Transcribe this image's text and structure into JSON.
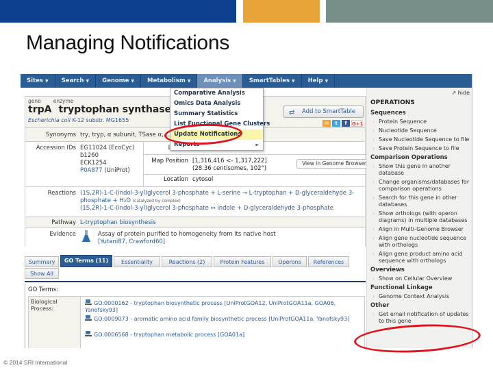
{
  "slide": {
    "title": "Managing Notifications",
    "footer": "© 2014 SRI International",
    "colors": {
      "blue": "#0d4190",
      "orange": "#e8a43a",
      "gray": "#788e88",
      "annotation": "#e0141c"
    }
  },
  "nav": {
    "items": [
      {
        "label": "Sites"
      },
      {
        "label": "Search"
      },
      {
        "label": "Genome"
      },
      {
        "label": "Metabolism"
      },
      {
        "label": "Analysis",
        "active": true
      },
      {
        "label": "SmartTables"
      },
      {
        "label": "Help"
      }
    ],
    "caret": "▼"
  },
  "analysis_menu": {
    "items": [
      {
        "label": "Comparative Analysis"
      },
      {
        "label": "Omics Data Analysis"
      },
      {
        "label": "Summary Statistics"
      },
      {
        "label": "List Functional Gene Clusters"
      },
      {
        "label": "Update Notifications",
        "highlighted": true
      },
      {
        "label": "Reports",
        "submenu": true
      }
    ],
    "submenu_arrow": "►"
  },
  "gene": {
    "type_label": "gene",
    "enzyme_label": "enzyme",
    "symbol": "trpA",
    "name": "tryptophan synthase, α subunit",
    "organism_italic": "Escherichia coli",
    "organism_rest": " K-12 substr. MG1655",
    "add_smarttable": "Add to SmartTable",
    "share_icons": [
      "email",
      "twitter",
      "facebook",
      "G+1"
    ],
    "synonyms_label": "Synonyms",
    "synonyms": "try, tryp, α subunit, TSase α, ...",
    "accession_label": "Accession IDs",
    "accessions": [
      "EG11024 (EcoCyc)",
      "b1260",
      "ECK1254"
    ],
    "accession_link": "P0A877",
    "accession_link_suffix": " (UniProt)",
    "length_label": "Length",
    "map_position_label": "Map Position",
    "map_position": "[1,316,416 <- 1,317,222]",
    "map_position_2": "(28.36 centisomes, 102°)",
    "genome_browser_button": "View in Genome Browser",
    "location_label": "Location",
    "location": "cytosol",
    "reactions_label": "Reactions",
    "reaction_1": "(1S,2R)-1-C-(indol-3-yl)glycerol 3-phosphate + L-serine → L-tryptophan + D-glyceraldehyde 3-phosphate + H₂O",
    "reaction_1_note": "(catalyzed by complex)",
    "reaction_2": "(1S,2R)-1-C-(indol-3-yl)glycerol 3-phosphate ↔ indole + D-glyceraldehyde 3-phosphate",
    "pathway_label": "Pathway",
    "pathway": "L-tryptophan biosynthesis",
    "evidence_label": "Evidence",
    "evidence_text": "Assay of protein purified to homogeneity from its native host",
    "evidence_refs": "[Yutani87, Crawford60]"
  },
  "tabs": {
    "items": [
      {
        "label": "Summary"
      },
      {
        "label": "GO Terms (11)",
        "active": true
      },
      {
        "label": "Essentiality"
      },
      {
        "label": "Reactions (2)"
      },
      {
        "label": "Protein Features"
      },
      {
        "label": "Operons"
      },
      {
        "label": "References"
      },
      {
        "label": "Show All"
      }
    ]
  },
  "go_terms": {
    "title": "GO Terms:",
    "category": "Biological Process:",
    "items": [
      {
        "text": "GO:0000162 - tryptophan biosynthetic process [UniProtGOA12, UniProtGOA11a, GOA06, Yanofsky93]"
      },
      {
        "text": "GO:0009073 - aromatic amino acid family biosynthetic process [UniProtGOA11a, Yanofsky93]"
      },
      {
        "text": "GO:0006568 - tryptophan metabolic process [GOA01a]"
      }
    ]
  },
  "operations": {
    "hide_label": "hide",
    "title": "OPERATIONS",
    "sections": [
      {
        "heading": "Sequences",
        "items": [
          "Protein Sequence",
          "Nucleotide Sequence",
          "Save Nucleotide Sequence to file",
          "Save Protein Sequence to file"
        ]
      },
      {
        "heading": "Comparison Operations",
        "items": [
          "Show this gene in another database",
          "Change organisms/databases for comparison operations",
          "Search for this gene in other databases",
          "Show orthologs (with operon diagrams) in multiple databases",
          "Align in Multi-Genome Browser",
          "Align gene nucleotide sequence with orthologs",
          "Align gene product amino acid sequence with orthologs"
        ]
      },
      {
        "heading": "Overviews",
        "items": [
          "Show on Cellular Overview"
        ]
      },
      {
        "heading": "Functional Linkage",
        "items": [
          "Genome Context Analysis"
        ]
      },
      {
        "heading": "Other",
        "items": [
          "Get email notification of updates to this gene"
        ]
      }
    ]
  }
}
